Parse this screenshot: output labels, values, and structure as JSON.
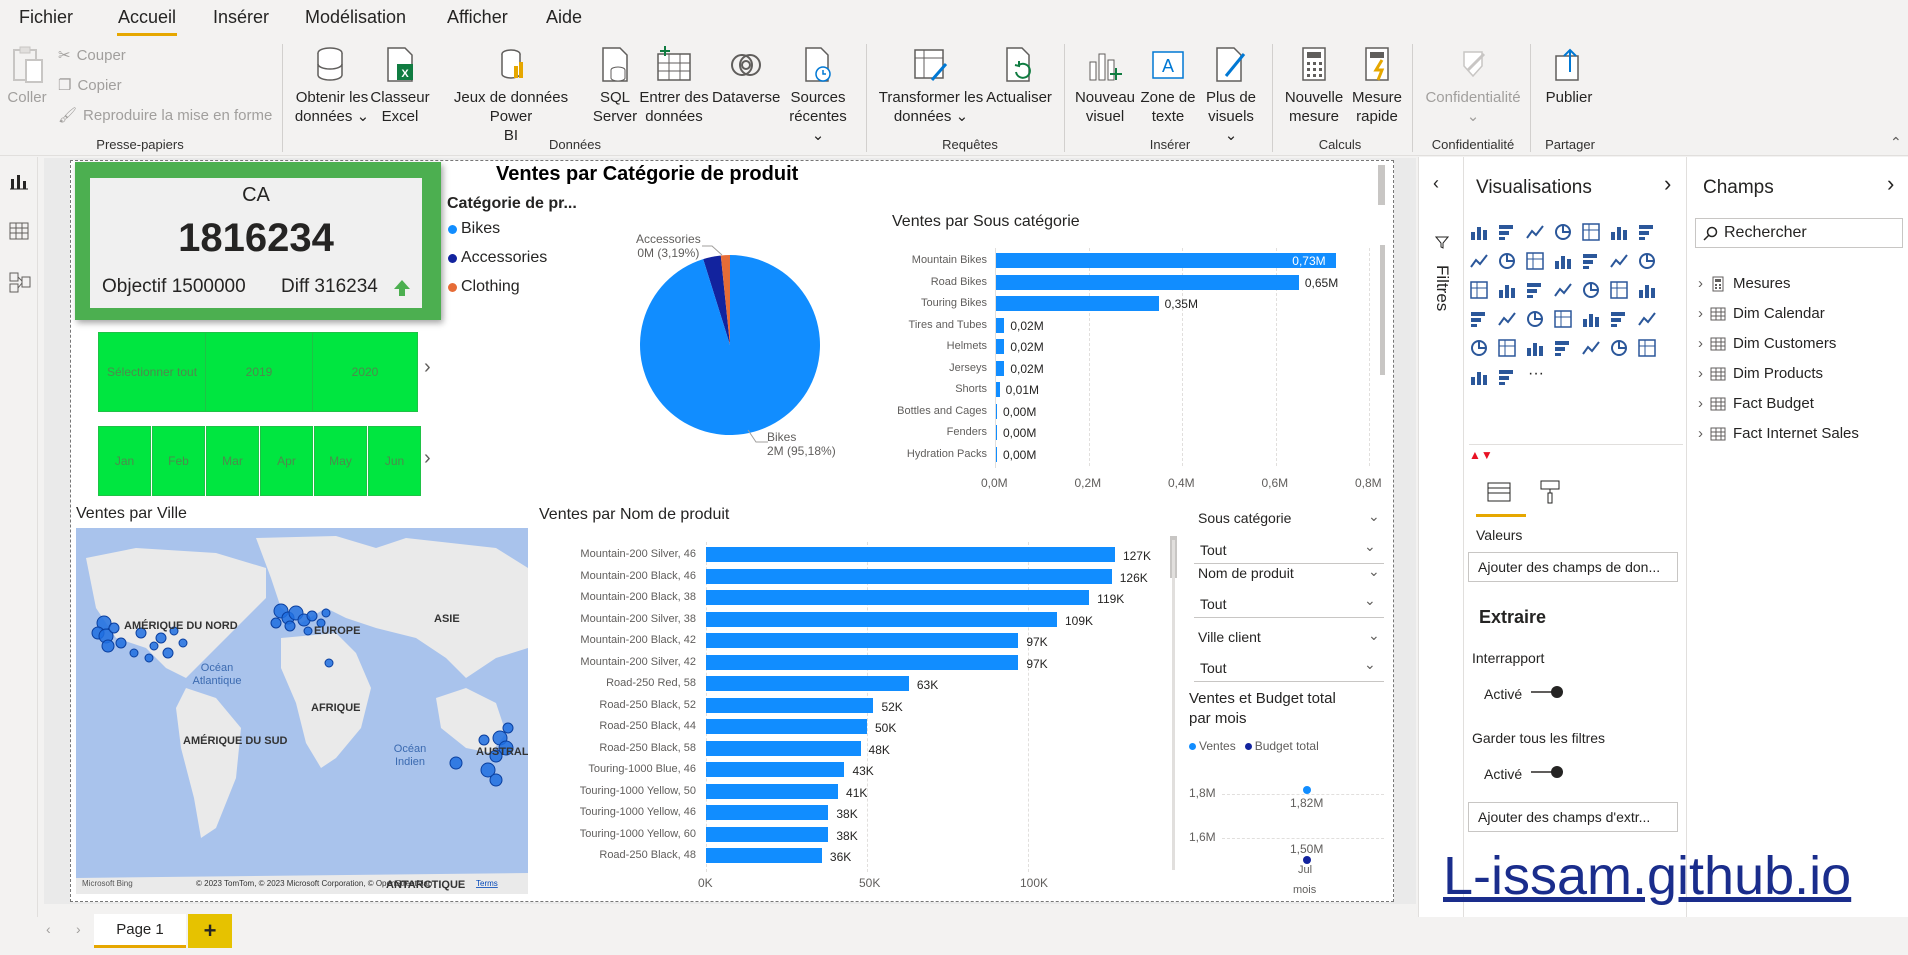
{
  "menu": {
    "items": [
      "Fichier",
      "Accueil",
      "Insérer",
      "Modélisation",
      "Afficher",
      "Aide"
    ]
  },
  "ribbon": {
    "clipboard": {
      "paste": "Coller",
      "cut": "Couper",
      "copy": "Copier",
      "format_painter": "Reproduire la mise en forme",
      "group": "Presse-papiers"
    },
    "data": {
      "get_data_1": "Obtenir les",
      "get_data_2": "données",
      "excel_1": "Classeur",
      "excel_2": "Excel",
      "datasets_1": "Jeux de données Power",
      "datasets_2": "BI",
      "sql_1": "SQL",
      "sql_2": "Server",
      "enter_1": "Entrer des",
      "enter_2": "données",
      "dataverse": "Dataverse",
      "recent_1": "Sources",
      "recent_2": "récentes",
      "group": "Données"
    },
    "queries": {
      "transform_1": "Transformer les",
      "transform_2": "données",
      "refresh": "Actualiser",
      "group": "Requêtes"
    },
    "insert": {
      "new_visual_1": "Nouveau",
      "new_visual_2": "visuel",
      "textbox_1": "Zone de",
      "textbox_2": "texte",
      "more_1": "Plus de",
      "more_2": "visuels",
      "group": "Insérer"
    },
    "calc": {
      "measure_1": "Nouvelle",
      "measure_2": "mesure",
      "quick_1": "Mesure",
      "quick_2": "rapide",
      "group": "Calculs"
    },
    "sensitivity": {
      "label": "Confidentialité",
      "group": "Confidentialité"
    },
    "share": {
      "publish": "Publier",
      "group": "Partager"
    }
  },
  "kpi": {
    "title": "CA",
    "value": "1816234",
    "goal": "Objectif 1500000",
    "diff": "Diff 316234",
    "accent": "#4caf50"
  },
  "year_slicer": [
    "Sélectionner tout",
    "2019",
    "2020"
  ],
  "month_slicer": [
    "Jan",
    "Feb",
    "Mar",
    "Apr",
    "May",
    "Jun"
  ],
  "pie": {
    "title": "Ventes par Catégorie de produit",
    "legend_title": "Catégorie de pr...",
    "legend": [
      {
        "name": "Bikes",
        "color": "#118dff"
      },
      {
        "name": "Accessories",
        "color": "#12239e"
      },
      {
        "name": "Clothing",
        "color": "#e66c37"
      }
    ],
    "label_accessories_1": "Accessories",
    "label_accessories_2": "0M (3,19%)",
    "label_bikes_1": "Bikes",
    "label_bikes_2": "2M (95,18%)"
  },
  "subcat_title": "Ventes par Sous catégorie",
  "subcat_axis": [
    "0,0M",
    "0,2M",
    "0,4M",
    "0,6M",
    "0,8M"
  ],
  "product_title": "Ventes par Nom de produit",
  "product_axis": [
    "0K",
    "50K",
    "100K"
  ],
  "map": {
    "title": "Ventes par Ville",
    "labels": [
      "AMÉRIQUE DU NORD",
      "EUROPE",
      "ASIE",
      "AFRIQUE",
      "AMÉRIQUE DU SUD",
      "AUSTRAL",
      "ANTARCTIQUE"
    ],
    "ocean_atl_1": "Océan",
    "ocean_atl_2": "Atlantique",
    "ocean_ind_1": "Océan",
    "ocean_ind_2": "Indien",
    "credit": "© 2023 TomTom, © 2023 Microsoft Corporation, © OpenStreetMap",
    "terms": "Terms",
    "bing": "Microsoft Bing"
  },
  "filters_dd": [
    {
      "label": "Sous catégorie",
      "value": "Tout"
    },
    {
      "label": "Nom de produit",
      "value": "Tout"
    },
    {
      "label": "Ville client",
      "value": "Tout"
    }
  ],
  "line_chart": {
    "title_1": "Ventes et Budget total",
    "title_2": "par mois",
    "legend": [
      "Ventes",
      "Budget total"
    ],
    "y_ticks": [
      "1,8M",
      "1,6M"
    ],
    "label_sales": "1,82M",
    "label_budget": "1,50M",
    "x_1": "Jul",
    "x_2": "mois"
  },
  "chart_data": [
    {
      "type": "pie",
      "title": "Ventes par Catégorie de produit",
      "categories": [
        "Bikes",
        "Accessories",
        "Clothing"
      ],
      "values": [
        95.18,
        3.19,
        1.63
      ]
    },
    {
      "type": "bar",
      "title": "Ventes par Sous catégorie",
      "categories": [
        "Mountain Bikes",
        "Road Bikes",
        "Touring Bikes",
        "Tires and Tubes",
        "Helmets",
        "Jerseys",
        "Shorts",
        "Bottles and Cages",
        "Fenders",
        "Hydration Packs"
      ],
      "values": [
        0.73,
        0.65,
        0.35,
        0.02,
        0.02,
        0.02,
        0.01,
        0.0,
        0.0,
        0.0
      ],
      "labels": [
        "0,73M",
        "0,65M",
        "0,35M",
        "0,02M",
        "0,02M",
        "0,02M",
        "0,01M",
        "0,00M",
        "0,00M",
        "0,00M"
      ],
      "xlim": [
        0,
        0.8
      ]
    },
    {
      "type": "bar",
      "title": "Ventes par Nom de produit",
      "categories": [
        "Mountain-200 Silver, 46",
        "Mountain-200 Black, 46",
        "Mountain-200 Black, 38",
        "Mountain-200 Silver, 38",
        "Mountain-200 Black, 42",
        "Mountain-200 Silver, 42",
        "Road-250 Red, 58",
        "Road-250 Black, 52",
        "Road-250 Black, 44",
        "Road-250 Black, 58",
        "Touring-1000 Blue, 46",
        "Touring-1000 Yellow, 50",
        "Touring-1000 Yellow, 46",
        "Touring-1000 Yellow, 60",
        "Road-250 Black, 48"
      ],
      "values": [
        127,
        126,
        119,
        109,
        97,
        97,
        63,
        52,
        50,
        48,
        43,
        41,
        38,
        38,
        36
      ],
      "labels": [
        "127K",
        "126K",
        "119K",
        "109K",
        "97K",
        "97K",
        "63K",
        "52K",
        "50K",
        "48K",
        "43K",
        "41K",
        "38K",
        "38K",
        "36K"
      ],
      "xlim": [
        0,
        135
      ]
    },
    {
      "type": "line",
      "title": "Ventes et Budget total par mois",
      "x": [
        "Jul"
      ],
      "series": [
        {
          "name": "Ventes",
          "values": [
            1.82
          ]
        },
        {
          "name": "Budget total",
          "values": [
            1.5
          ]
        }
      ]
    }
  ],
  "viz_pane": {
    "title": "Visualisations",
    "values_label": "Valeurs",
    "values_btn": "Ajouter des champs de don...",
    "drill_title": "Extraire",
    "cross_report": "Interrapport",
    "cross_state": "Activé",
    "keep_filters": "Garder tous les filtres",
    "keep_state": "Activé",
    "drill_btn": "Ajouter des champs d'extr..."
  },
  "filters_pane": {
    "label": "Filtres"
  },
  "fields_pane": {
    "title": "Champs",
    "search_placeholder": "Rechercher",
    "tables": [
      "Mesures",
      "Dim Calendar",
      "Dim Customers",
      "Dim Products",
      "Fact Budget",
      "Fact Internet Sales"
    ]
  },
  "pages": {
    "current": "Page 1",
    "add": "+"
  },
  "watermark": "L-issam.github.io"
}
